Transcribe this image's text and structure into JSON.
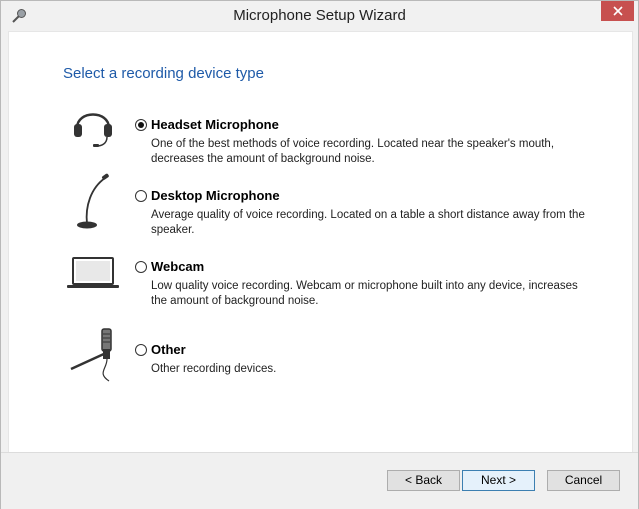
{
  "window": {
    "title": "Microphone Setup Wizard"
  },
  "heading": "Select a recording device type",
  "options": [
    {
      "label": "Headset Microphone",
      "description": "One of the best methods of voice recording. Located near the speaker's mouth, decreases the amount of background noise.",
      "selected": true
    },
    {
      "label": "Desktop Microphone",
      "description": "Average quality of voice recording. Located on a table a short distance away from the speaker.",
      "selected": false
    },
    {
      "label": "Webcam",
      "description": "Low quality voice recording. Webcam or microphone built into any device, increases the amount of background noise.",
      "selected": false
    },
    {
      "label": "Other",
      "description": "Other recording devices.",
      "selected": false
    }
  ],
  "buttons": {
    "back": "< Back",
    "next": "Next >",
    "cancel": "Cancel"
  },
  "colors": {
    "heading": "#1e5aa8",
    "close": "#c7504f"
  },
  "icons": {
    "app": "microphone-icon",
    "close": "close-icon"
  }
}
